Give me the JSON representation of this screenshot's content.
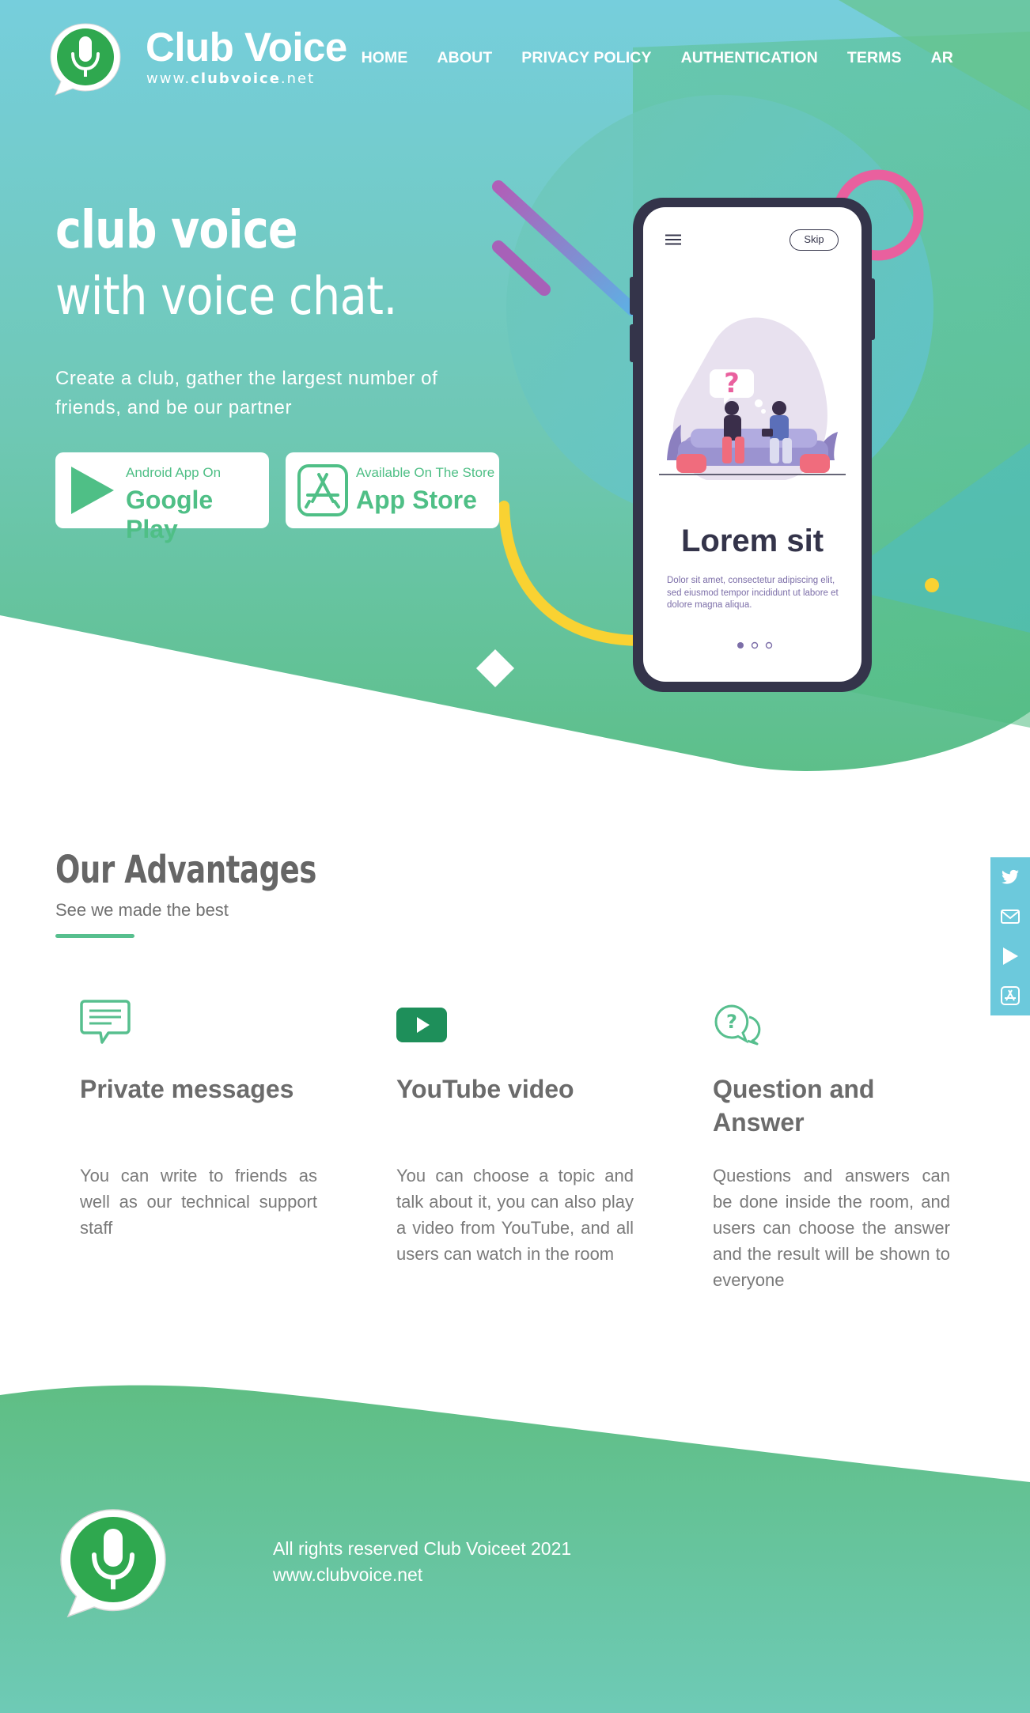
{
  "brand": {
    "name": "Club Voice",
    "url_prefix": "www.",
    "url_bold": "clubvoice",
    "url_suffix": ".net"
  },
  "nav": [
    {
      "label": "HOME"
    },
    {
      "label": "ABOUT"
    },
    {
      "label": "PRIVACY POLICY"
    },
    {
      "label": "AUTHENTICATION"
    },
    {
      "label": "TERMS"
    },
    {
      "label": "AR"
    }
  ],
  "hero": {
    "title": "club voice",
    "subtitle": "with voice chat.",
    "description": "Create a club, gather the largest number of friends, and be our partner",
    "google_play": {
      "small": "Android App On",
      "big": "Google Play",
      "icon": "play-icon"
    },
    "app_store": {
      "small": "Available On The Store",
      "big": "App Store",
      "icon": "app-store-icon"
    }
  },
  "phone": {
    "skip_label": "Skip",
    "title": "Lorem sit",
    "text": "Dolor sit amet, consectetur adipiscing elit, sed eiusmod tempor incididunt ut labore et dolore magna aliqua.",
    "pagination": {
      "current": 1,
      "total": 3
    }
  },
  "social": [
    "twitter-icon",
    "mail-icon",
    "play-icon",
    "app-store-icon"
  ],
  "advantages": {
    "title": "Our Advantages",
    "subtitle": "See we made the best",
    "items": [
      {
        "icon": "message-icon",
        "title": "Private messages",
        "desc": "You can write to friends as well as our technical support staff"
      },
      {
        "icon": "youtube-icon",
        "title": "YouTube video",
        "desc": "You can choose a topic and talk about it, you can also play a video from YouTube, and all users can watch in the room"
      },
      {
        "icon": "question-chat-icon",
        "title": "Question and Answer",
        "desc": "Questions and answers can be done inside the room, and users can choose the answer and the result will be shown to everyone"
      }
    ]
  },
  "footer": {
    "copyright": "All rights reserved Club Voiceet 2021",
    "url": "www.clubvoice.net"
  },
  "colors": {
    "primary_green": "#57bf8e",
    "hero_teal": "#74cbd9",
    "text_gray": "#6b6b6b",
    "accent_pink": "#e9609e",
    "accent_yellow": "#f9d232",
    "phone_dark": "#34344a"
  }
}
